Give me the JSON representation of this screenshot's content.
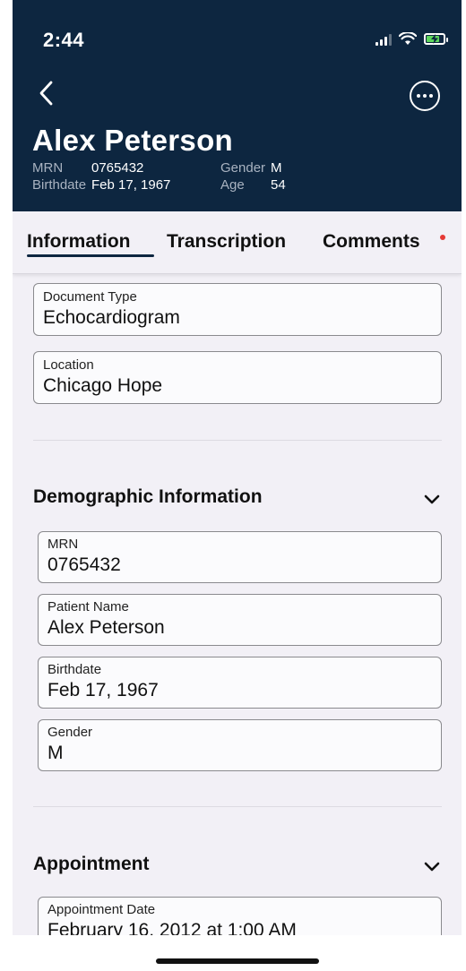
{
  "status_bar": {
    "time": "2:44"
  },
  "header": {
    "patient_name": "Alex Peterson",
    "mrn_label": "MRN",
    "mrn_value": "0765432",
    "birthdate_label": "Birthdate",
    "birthdate_value": "Feb 17, 1967",
    "gender_label": "Gender",
    "gender_value": "M",
    "age_label": "Age",
    "age_value": "54"
  },
  "tabs": [
    {
      "label": "Information",
      "active": true
    },
    {
      "label": "Transcription",
      "active": false
    },
    {
      "label": "Comments",
      "active": false,
      "has_notification": true
    }
  ],
  "document_fields": [
    {
      "label": "Document Type",
      "value": "Echocardiogram"
    },
    {
      "label": "Location",
      "value": "Chicago Hope"
    }
  ],
  "demographic": {
    "title": "Demographic Information",
    "fields": [
      {
        "label": "MRN",
        "value": "0765432"
      },
      {
        "label": "Patient Name",
        "value": "Alex Peterson"
      },
      {
        "label": "Birthdate",
        "value": "Feb 17, 1967"
      },
      {
        "label": "Gender",
        "value": "M"
      }
    ]
  },
  "appointment": {
    "title": "Appointment",
    "fields": [
      {
        "label": "Appointment Date",
        "value": "February 16, 2012 at 1:00 AM"
      }
    ]
  },
  "colors": {
    "header_bg": "#0d2640",
    "page_bg": "#f2f0f6",
    "notification_dot": "#e53935",
    "battery_charging": "#5cd65c"
  },
  "icons": [
    "signal-icon",
    "wifi-icon",
    "battery-charging-icon",
    "back-chevron-icon",
    "more-options-icon",
    "chevron-down-icon"
  ]
}
